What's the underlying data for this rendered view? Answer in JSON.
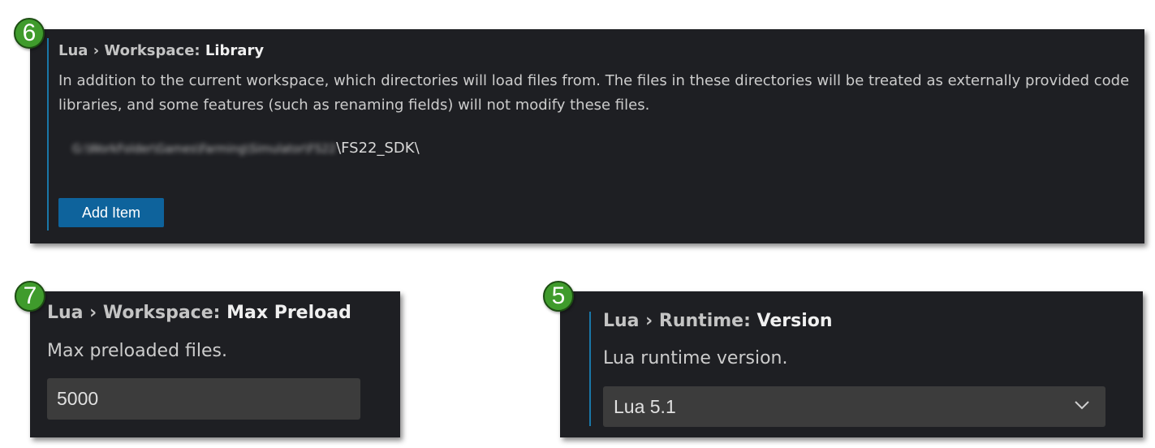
{
  "library_setting": {
    "badge": "6",
    "category": "Lua › Workspace: ",
    "key": "Library",
    "description": "In addition to the current workspace, which directories will load files from. The files in these directories will be treated as externally provided code libraries, and some features (such as renaming fields) will not modify these files.",
    "item_prefix_blurred": "G:\\WorkFolder\\Games\\Farming\\Simulator\\FS22",
    "item_suffix": "\\FS22_SDK\\",
    "add_button": "Add Item"
  },
  "max_preload_setting": {
    "badge": "7",
    "category": "Lua › Workspace: ",
    "key": "Max Preload",
    "description": "Max preloaded files.",
    "value": "5000"
  },
  "runtime_version_setting": {
    "badge": "5",
    "category": "Lua › Runtime: ",
    "key": "Version",
    "description": "Lua runtime version.",
    "selected": "Lua 5.1"
  },
  "colors": {
    "panel_bg": "#1e1f23",
    "accent": "#1a77a8",
    "button": "#0e639c",
    "input_bg": "#3c3c3c",
    "badge_green": "#3f9b2c"
  }
}
